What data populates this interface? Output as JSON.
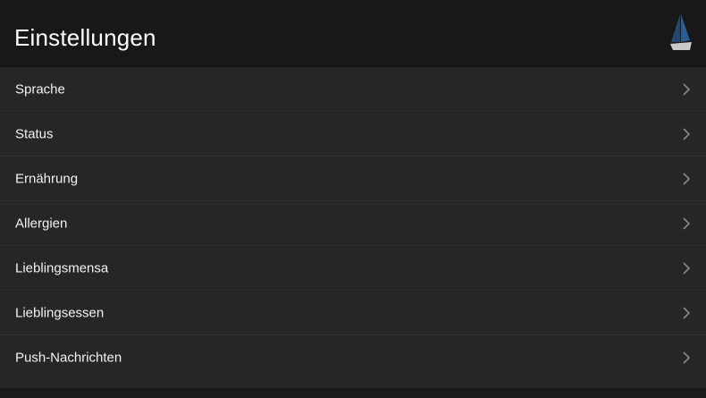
{
  "header": {
    "title": "Einstellungen",
    "logo_icon": "sailboat-icon"
  },
  "settings": {
    "items": [
      {
        "label": "Sprache",
        "icon": "chevron-right-icon"
      },
      {
        "label": "Status",
        "icon": "chevron-right-icon"
      },
      {
        "label": "Ernährung",
        "icon": "chevron-right-icon"
      },
      {
        "label": "Allergien",
        "icon": "chevron-right-icon"
      },
      {
        "label": "Lieblingsmensa",
        "icon": "chevron-right-icon"
      },
      {
        "label": "Lieblingsessen",
        "icon": "chevron-right-icon"
      },
      {
        "label": "Push-Nachrichten",
        "icon": "chevron-right-icon"
      }
    ]
  },
  "colors": {
    "header_bg": "#181818",
    "list_bg": "#262626",
    "text": "#f2f2f2",
    "chevron": "#8a8a8a",
    "sail": "#2d5d8f"
  }
}
